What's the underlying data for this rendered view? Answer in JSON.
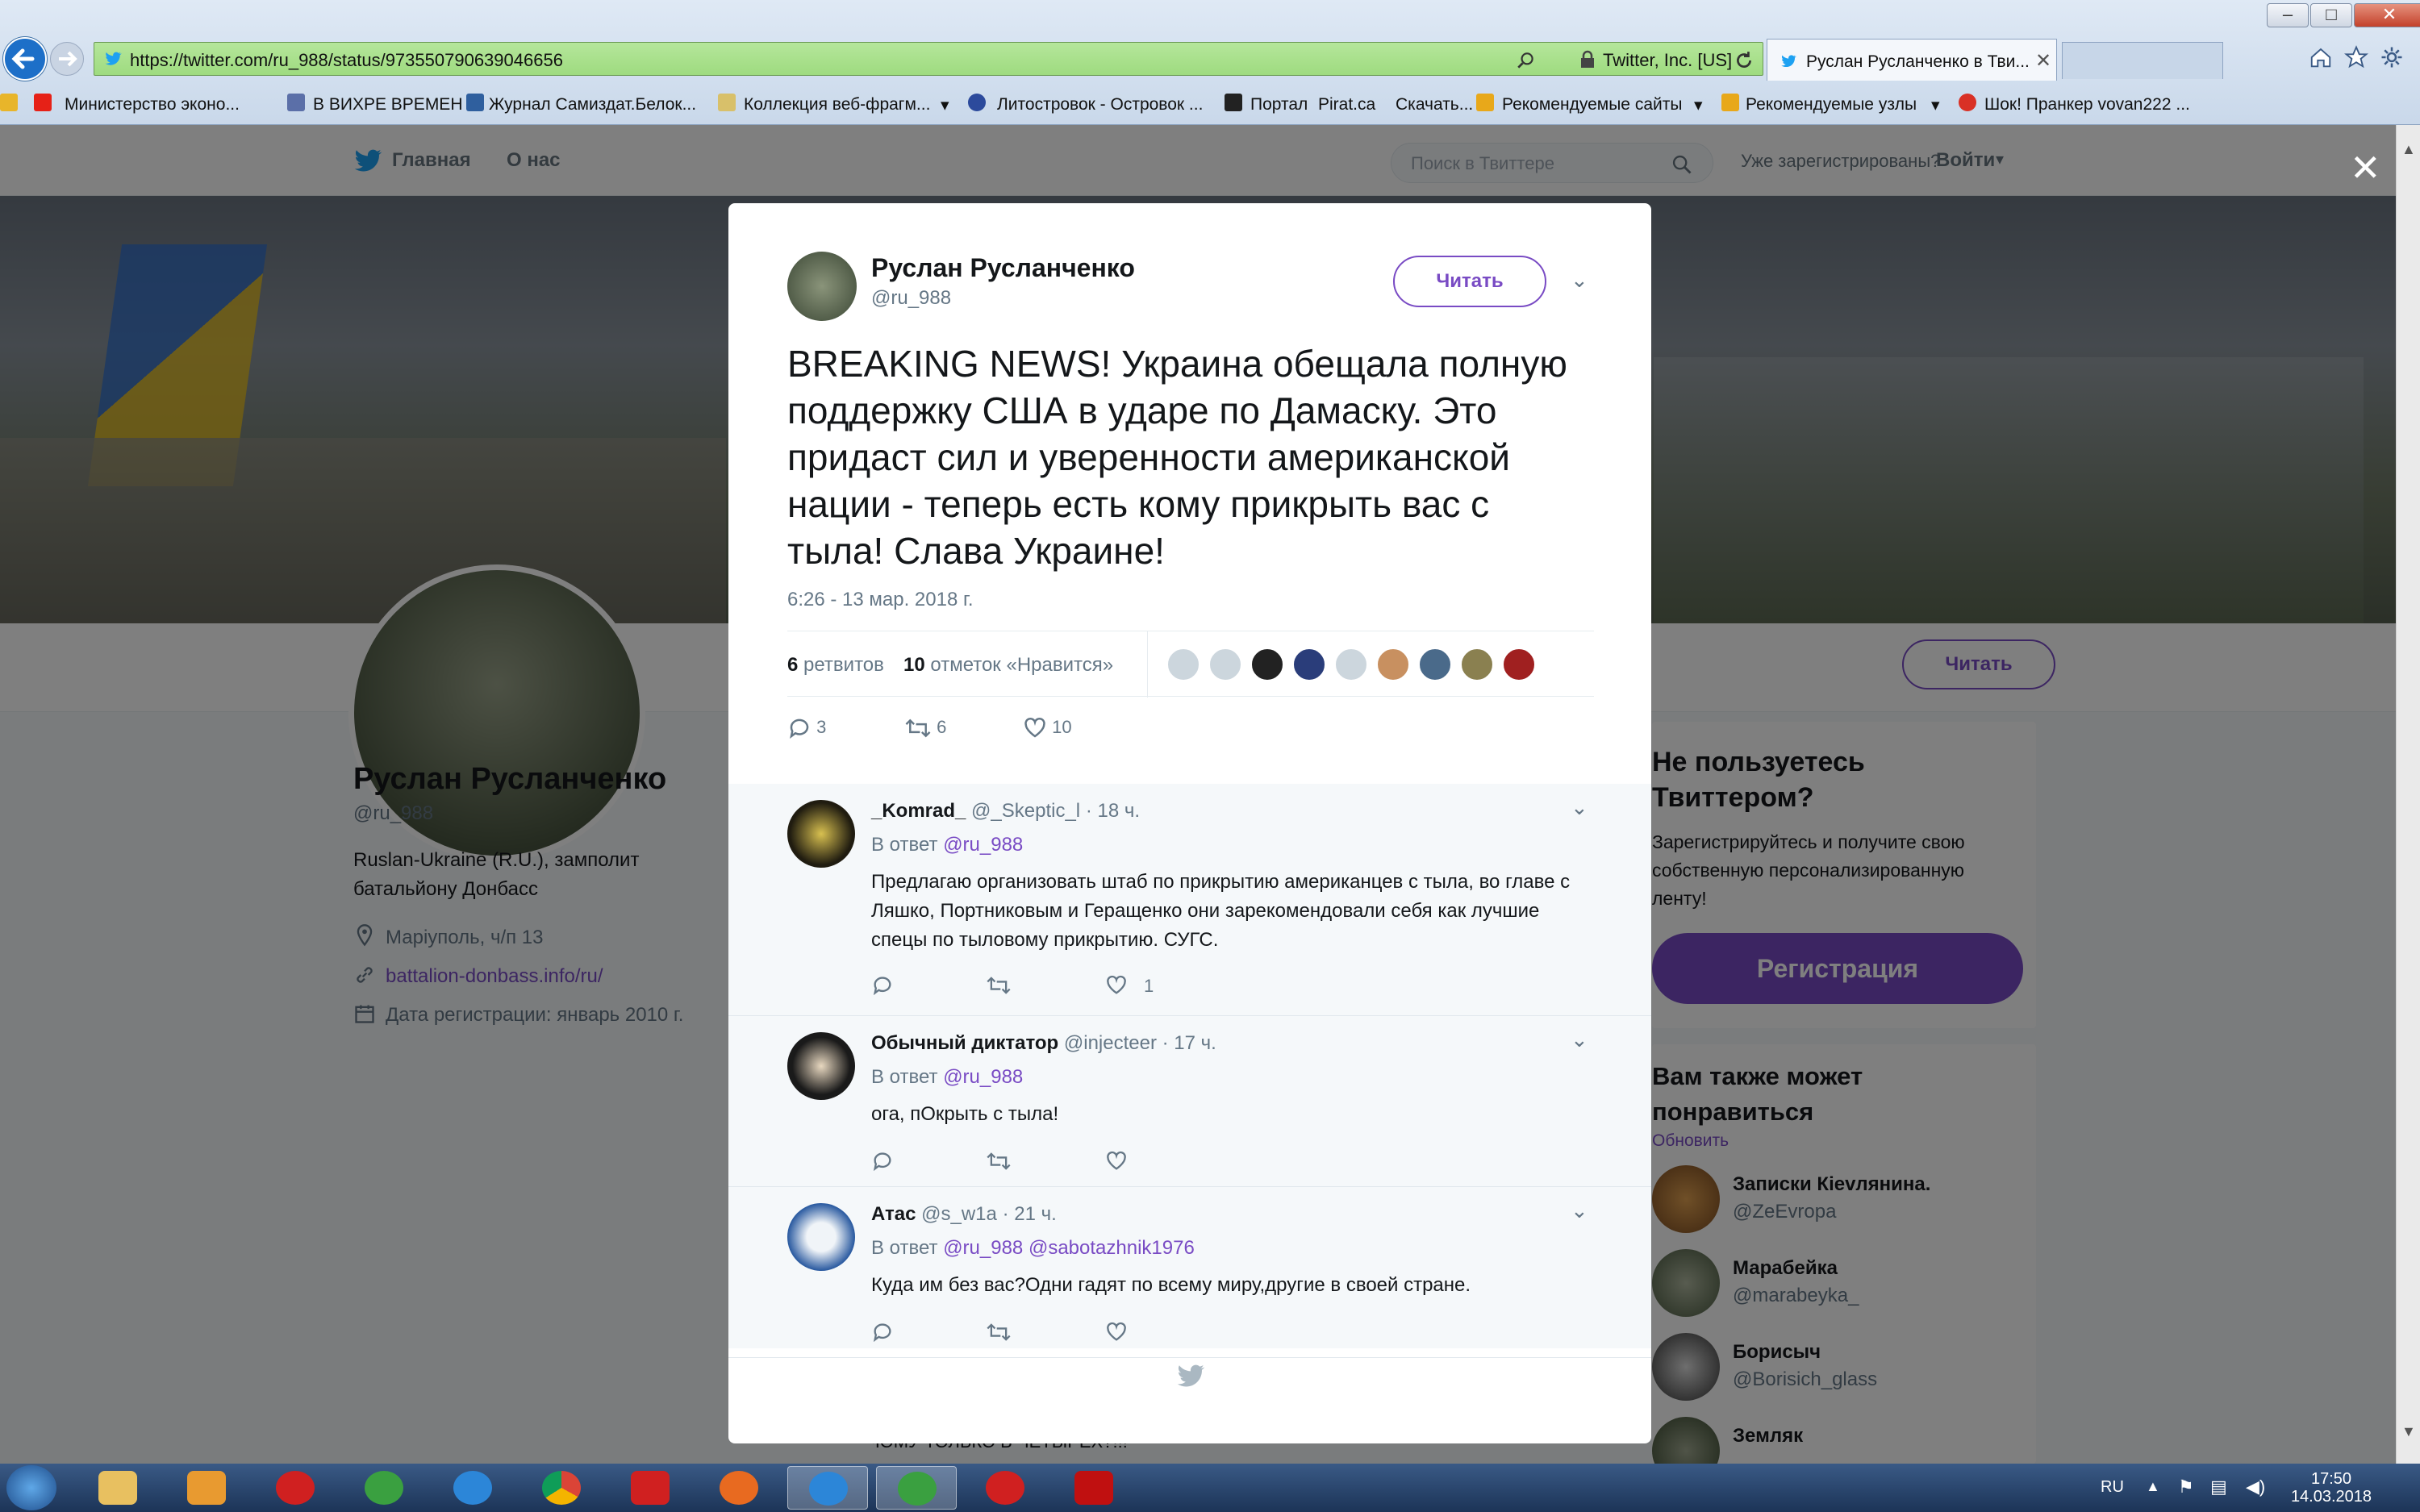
{
  "browser": {
    "url": "https://twitter.com/ru_988/status/973550790639046656",
    "cert": "Twitter, Inc. [US]",
    "tab_title": "Руслан Русланченко в Тви...",
    "bookmarks": [
      "Министерство эконо...",
      "В ВИХРЕ ВРЕМЕН",
      "Журнал Самиздат.Белок...",
      "Коллекция веб-фрагм...",
      "Литостровок - Островок ...",
      "Портал",
      "Pirat.ca",
      "Скачать...",
      "Рекомендуемые сайты",
      "Рекомендуемые узлы",
      "Шок! Пранкер vovan222 ..."
    ]
  },
  "twitter_nav": {
    "home": "Главная",
    "about": "О нас",
    "search_placeholder": "Поиск в Твиттере",
    "registered": "Уже зарегистрированы?",
    "login": "Войти"
  },
  "profile": {
    "name": "Руслан Русланченко",
    "handle": "@ru_988",
    "bio_line1": "Ruslan-Ukraine (R.U.), замполит",
    "bio_line2": "батальйону Донбасс",
    "location": "Маріуполь, ч/п 13",
    "link": "battalion-donbass.info/ru/",
    "joined": "Дата регистрации: январь 2010 г.",
    "follow": "Читать"
  },
  "tweet": {
    "name": "Руслан Русланченко",
    "handle": "@ru_988",
    "follow": "Читать",
    "text": "BREAKING NEWS! Украина обещала полную поддержку США в ударе по Дамаску. Это придаст сил и уверенности американской нации - теперь есть кому прикрыть вас с тыла! Слава Украине!",
    "time": "6:26 - 13 мар. 2018 г.",
    "retweets_count": "6",
    "retweets_label": "ретвитов",
    "likes_count": "10",
    "likes_label": "отметок «Нравится»",
    "reply_count": "3",
    "retweet_count": "6",
    "like_count": "10"
  },
  "replies": [
    {
      "name": "_Komrad_",
      "handle": "@_Skeptic_l",
      "time": "· 18 ч.",
      "reply_to_label": "В ответ",
      "reply_to": "@ru_988",
      "text": "Предлагаю организовать штаб по прикрытию американцев с тыла, во главе с Ляшко, Портниковым и Геращенко они зарекомендовали себя как лучшие спецы по тыловому прикрытию. СУГС.",
      "likes": "1"
    },
    {
      "name": "Обычный диктатор",
      "handle": "@injecteer",
      "time": "· 17 ч.",
      "reply_to_label": "В ответ",
      "reply_to": "@ru_988",
      "text": "ога, пОкрыть с тыла!",
      "likes": ""
    },
    {
      "name": "Атас",
      "handle": "@s_w1a",
      "time": "· 21 ч.",
      "reply_to_label": "В ответ",
      "reply_to": "@ru_988 @sabotazhnik1976",
      "text": "Куда им без вас?Одни гадят по всему миру,другие в своей стране.",
      "likes": ""
    }
  ],
  "right_column": {
    "signup_title": "Не пользуетесь Твиттером?",
    "signup_text": "Зарегистрируйтесь и получите свою собственную персонализированную ленту!",
    "signup_button": "Регистрация",
    "wtf_title": "Вам также может понравиться",
    "refresh": "Обновить",
    "suggestions": [
      {
        "name": "Записки Кievлянина.",
        "handle": "@ZeEvropa"
      },
      {
        "name": "Марабейка",
        "handle": "@marabeyka_"
      },
      {
        "name": "Борисыч",
        "handle": "@Borisich_glass"
      },
      {
        "name": "Земляк",
        "handle": ""
      }
    ]
  },
  "timeline_peek": "ЧОМУ ТОЛЬКО В ЧЕТЫРЕХ?!!!",
  "taskbar": {
    "lang": "RU",
    "time": "17:50",
    "date": "14.03.2018"
  }
}
